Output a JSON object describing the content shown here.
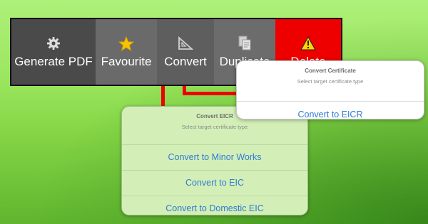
{
  "toolbar": {
    "generate_pdf": {
      "label": "Generate PDF",
      "icon": "gear-icon"
    },
    "favourite": {
      "label": "Favourite",
      "icon": "star-icon"
    },
    "convert": {
      "label": "Convert",
      "icon": "set-square-icon"
    },
    "duplicate": {
      "label": "Duplicate",
      "icon": "duplicate-document-icon"
    },
    "delete": {
      "label": "Delete",
      "icon": "warning-icon"
    }
  },
  "popover_cert": {
    "title": "Convert Certificate",
    "subtitle": "Select target certificate type",
    "options": [
      "Convert to EICR"
    ]
  },
  "popover_eicr": {
    "title": "Convert EICR",
    "subtitle": "Select target certificate type",
    "options": [
      "Convert to Minor Works",
      "Convert to EIC",
      "Convert to Domestic EIC"
    ]
  },
  "colors": {
    "background": "#9be65f",
    "delete_red": "#ee0000",
    "link_blue": "#2f7bd4",
    "star_yellow": "#f5c400"
  }
}
